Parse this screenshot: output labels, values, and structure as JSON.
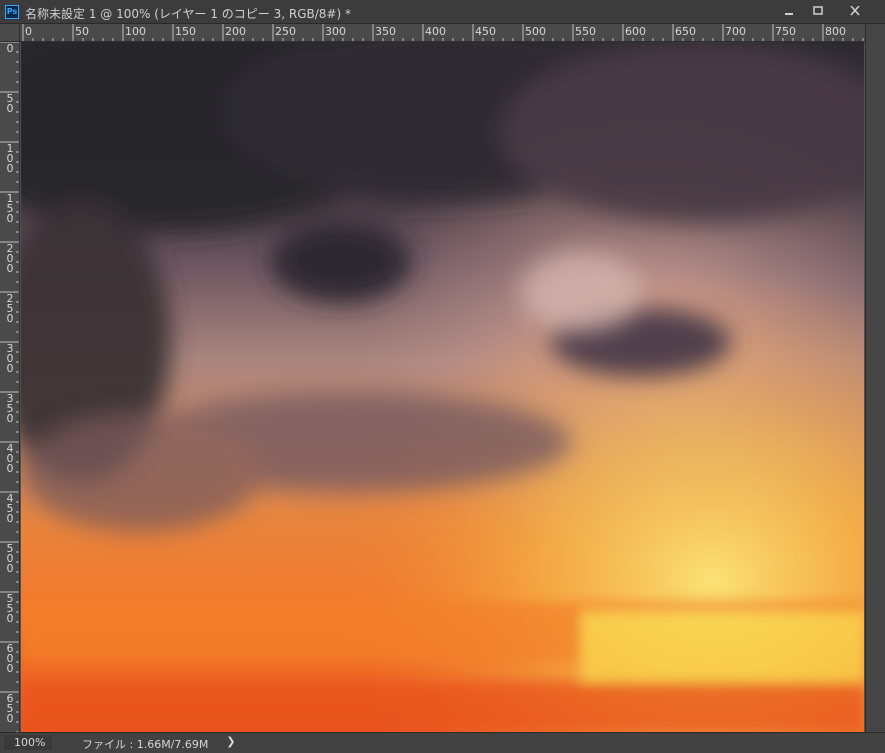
{
  "window": {
    "app_icon": "Ps",
    "title": "名称未設定 1 @ 100% (レイヤー 1 のコピー 3, RGB/8#) *",
    "buttons": {
      "minimize": "minimize-icon",
      "maximize": "maximize-icon",
      "close": "close-icon"
    }
  },
  "ruler": {
    "units": "px",
    "horizontal_labels": [
      "0",
      "50",
      "100",
      "150",
      "200",
      "250",
      "300",
      "350",
      "400",
      "450",
      "500",
      "550",
      "600",
      "650",
      "700",
      "750",
      "800"
    ],
    "vertical_labels": [
      "0",
      "50",
      "100",
      "150",
      "200",
      "250",
      "300",
      "350",
      "400",
      "450",
      "500",
      "550",
      "600",
      "650"
    ]
  },
  "canvas": {
    "content": "sunset-sky-photo",
    "colors": {
      "dark_cloud": "#2b2a30",
      "mauve_cloud": "#8e6f78",
      "orange": "#f07028",
      "yellow": "#f6d25a",
      "red_orange": "#ee5522"
    }
  },
  "status": {
    "zoom": "100%",
    "doc_info": "ファイル : 1.66M/7.69M",
    "arrow": "❯"
  }
}
